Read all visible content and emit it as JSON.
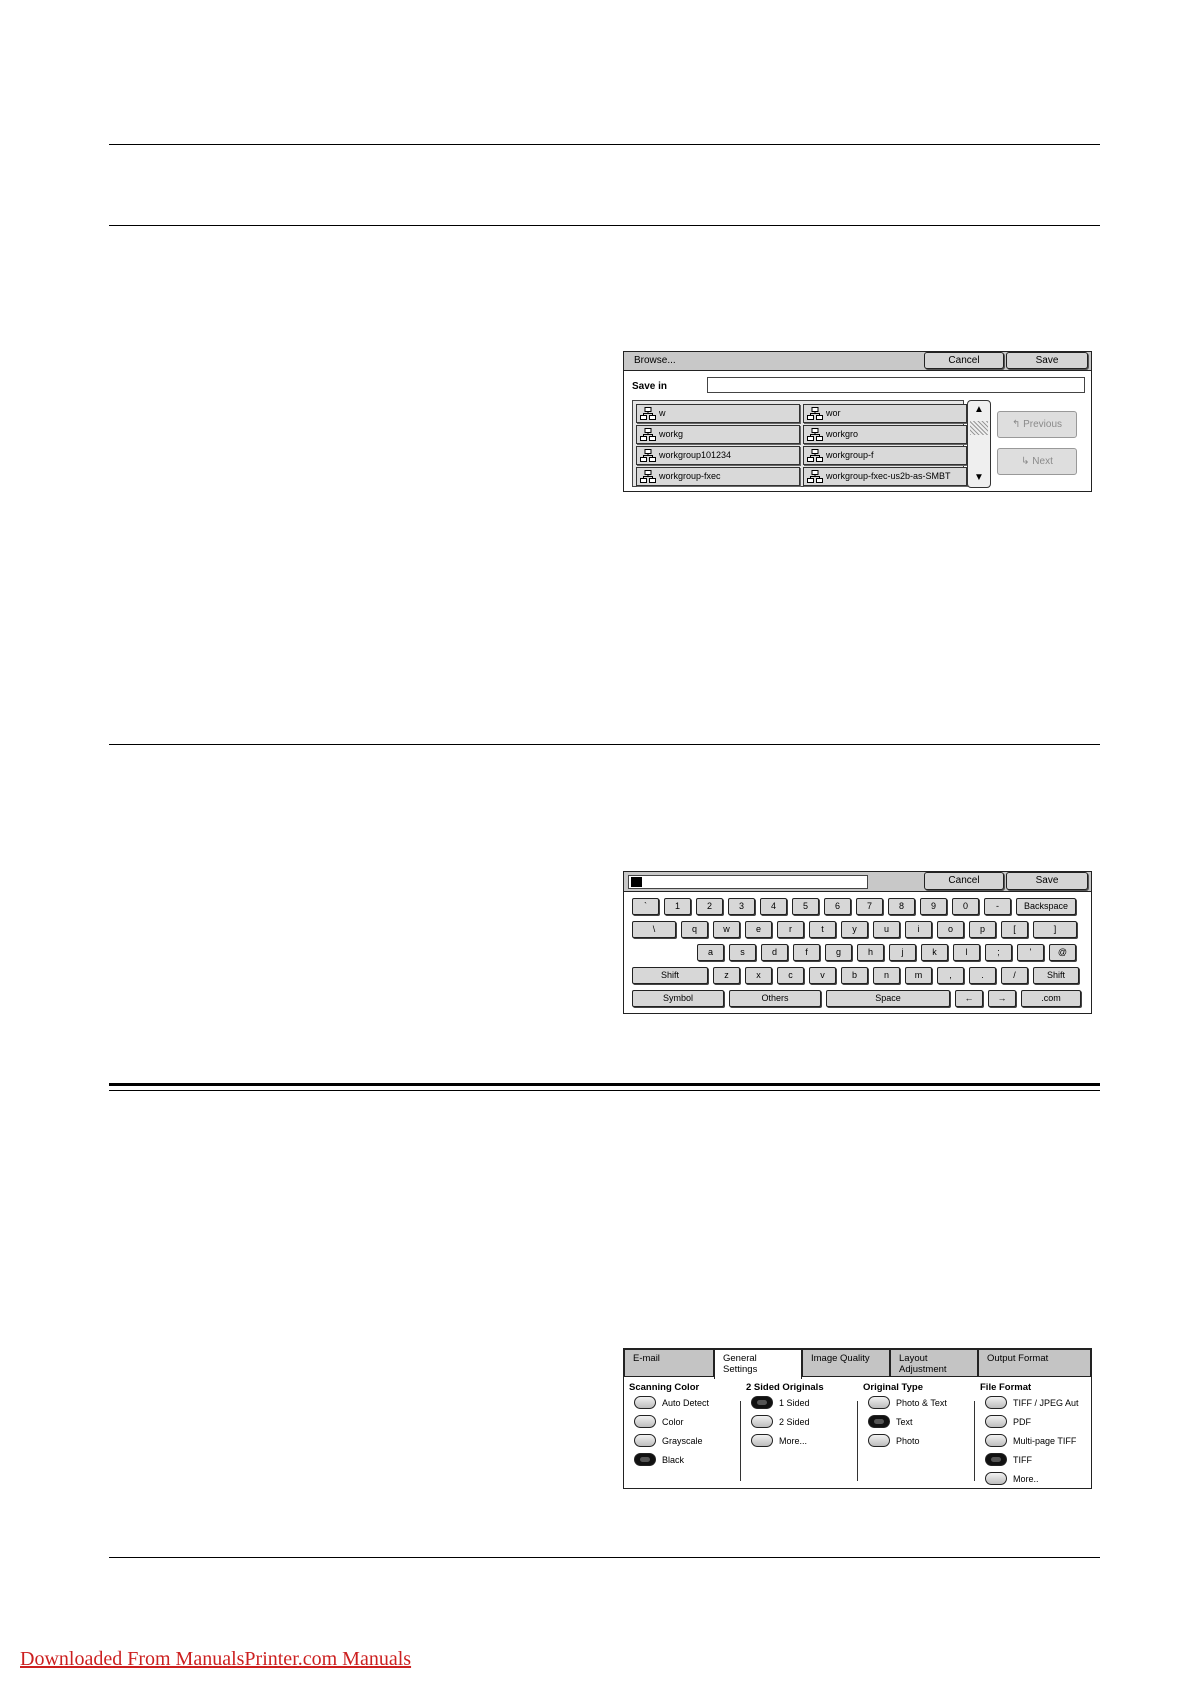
{
  "browse": {
    "title": "Browse...",
    "cancel": "Cancel",
    "save": "Save",
    "save_in_label": "Save in",
    "save_in_value": "",
    "folders": [
      "w",
      "wor",
      "workg",
      "workgro",
      "workgroup101234",
      "workgroup-f",
      "workgroup-fxec",
      "workgroup-fxec-us2b-as-SMBT"
    ],
    "previous": "Previous",
    "next": "Next"
  },
  "keyboard": {
    "cancel": "Cancel",
    "save": "Save",
    "row1": [
      "`",
      "1",
      "2",
      "3",
      "4",
      "5",
      "6",
      "7",
      "8",
      "9",
      "0",
      "-",
      "Backspace"
    ],
    "row2": [
      "\\",
      "q",
      "w",
      "e",
      "r",
      "t",
      "y",
      "u",
      "i",
      "o",
      "p",
      "[",
      "]"
    ],
    "row3": [
      "a",
      "s",
      "d",
      "f",
      "g",
      "h",
      "j",
      "k",
      "l",
      ";",
      "'",
      "@"
    ],
    "row4": [
      "Shift",
      "z",
      "x",
      "c",
      "v",
      "b",
      "n",
      "m",
      ",",
      ".",
      "/",
      "Shift"
    ],
    "row5": [
      "Symbol",
      "Others",
      "Space",
      "←",
      "→",
      ".com"
    ]
  },
  "settings": {
    "tabs": [
      "E-mail",
      "General\nSettings",
      "Image Quality",
      "Layout\nAdjustment",
      "Output Format"
    ],
    "active_tab": 1,
    "groups": [
      {
        "title": "Scanning Color",
        "options": [
          "Auto Detect",
          "Color",
          "Grayscale",
          "Black"
        ],
        "selected": 3
      },
      {
        "title": "2 Sided Originals",
        "options": [
          "1 Sided",
          "2 Sided",
          "More..."
        ],
        "selected": 0
      },
      {
        "title": "Original Type",
        "options": [
          "Photo & Text",
          "Text",
          "Photo"
        ],
        "selected": 1
      },
      {
        "title": "File Format",
        "options": [
          "TIFF / JPEG Aut",
          "PDF",
          "Multi-page TIFF",
          "TIFF",
          "More.."
        ],
        "selected": 3
      }
    ]
  },
  "footer": {
    "link_text": "Downloaded From ManualsPrinter.com Manuals"
  }
}
